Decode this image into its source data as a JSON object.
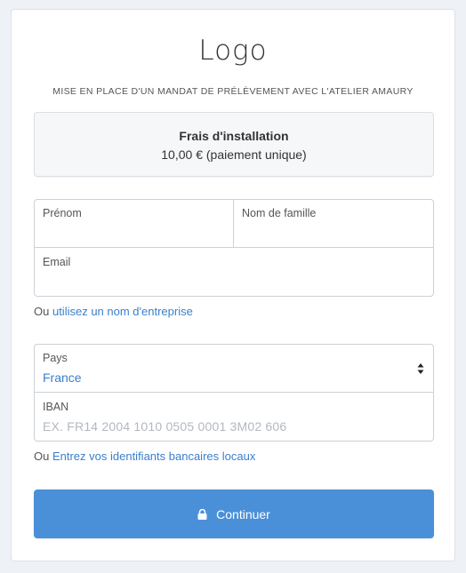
{
  "header": {
    "logo_text": "Logo",
    "subtitle": "MISE EN PLACE D'UN MANDAT DE PRÉLÈVEMENT AVEC L'ATELIER AMAURY"
  },
  "fee": {
    "title": "Frais d'installation",
    "amount": "10,00 € (paiement unique)"
  },
  "form": {
    "first_name_label": "Prénom",
    "last_name_label": "Nom de famille",
    "email_label": "Email",
    "company_prefix": "Ou",
    "company_link": "utilisez un nom d'entreprise",
    "country_label": "Pays",
    "country_value": "France",
    "iban_label": "IBAN",
    "iban_placeholder": "EX. FR14 2004 1010 0505 0001 3M02 606",
    "bank_prefix": "Ou",
    "bank_link": "Entrez vos identifiants bancaires locaux",
    "continue_label": "Continuer"
  },
  "icons": {
    "lock": "lock-icon",
    "select_arrows": "sort-arrows-icon"
  },
  "colors": {
    "accent": "#4a90d9",
    "link": "#3b7fcc",
    "background": "#eef1f5",
    "card": "#ffffff",
    "fee_box": "#f6f7f9"
  }
}
